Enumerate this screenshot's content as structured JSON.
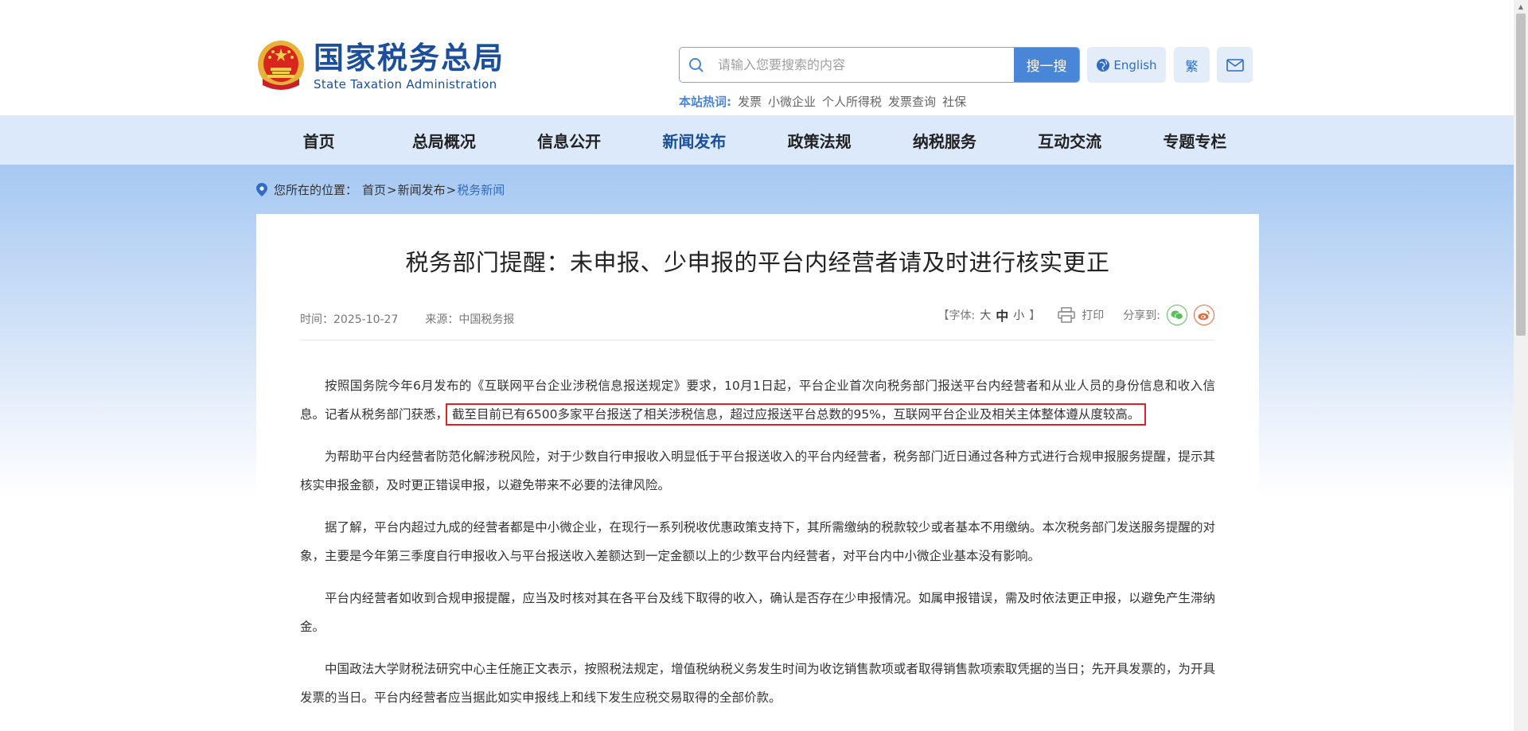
{
  "header": {
    "logo_cn": "国家税务总局",
    "logo_en": "State Taxation Administration",
    "search_placeholder": "请输入您要搜索的内容",
    "search_button": "搜一搜",
    "english_button": "English",
    "traditional_button": "繁",
    "hotwords_label": "本站热词:",
    "hotwords": [
      "发票",
      "小微企业",
      "个人所得税",
      "发票查询",
      "社保"
    ]
  },
  "nav": {
    "items": [
      "首页",
      "总局概况",
      "信息公开",
      "新闻发布",
      "政策法规",
      "纳税服务",
      "互动交流",
      "专题专栏"
    ],
    "active": "新闻发布"
  },
  "breadcrumb": {
    "label": "您所在的位置：",
    "home": "首页",
    "sep": ">",
    "level1": "新闻发布",
    "current": "税务新闻"
  },
  "article": {
    "title": "税务部门提醒：未申报、少申报的平台内经营者请及时进行核实更正",
    "time": "时间：2025-10-27",
    "source": "来源：中国税务报",
    "font_label_open": "【字体:",
    "font_large": "大",
    "font_medium": "中",
    "font_small": "小",
    "font_label_close": "】",
    "print": "打印",
    "share": "分享到:",
    "p1_a": "按照国务院今年6月发布的《互联网平台企业涉税信息报送规定》要求，10月1日起，平台企业首次向税务部门报送平台内经营者和从业人员的身份信息和收入信息。记者从税务部门获悉，",
    "p1_highlight": "截至目前已有6500多家平台报送了相关涉税信息，超过应报送平台总数的95%，互联网平台企业及相关主体整体遵从度较高。",
    "p2": "为帮助平台内经营者防范化解涉税风险，对于少数自行申报收入明显低于平台报送收入的平台内经营者，税务部门近日通过各种方式进行合规申报服务提醒，提示其核实申报金额，及时更正错误申报，以避免带来不必要的法律风险。",
    "p3": "据了解，平台内超过九成的经营者都是中小微企业，在现行一系列税收优惠政策支持下，其所需缴纳的税款较少或者基本不用缴纳。本次税务部门发送服务提醒的对象，主要是今年第三季度自行申报收入与平台报送收入差额达到一定金额以上的少数平台内经营者，对平台内中小微企业基本没有影响。",
    "p4": "平台内经营者如收到合规申报提醒，应当及时核对其在各平台及线下取得的收入，确认是否存在少申报情况。如属申报错误，需及时依法更正申报，以避免产生滞纳金。",
    "p5": "中国政法大学财税法研究中心主任施正文表示，按照税法规定，增值税纳税义务发生时间为收讫销售款项或者取得销售款项索取凭据的当日；先开具发票的，为开具发票的当日。平台内经营者应当据此如实申报线上和线下发生应税交易取得的全部价款。"
  },
  "colors": {
    "brand": "#1b4f9c",
    "accent": "#4a86d8",
    "highlight_border": "#dd2222"
  }
}
